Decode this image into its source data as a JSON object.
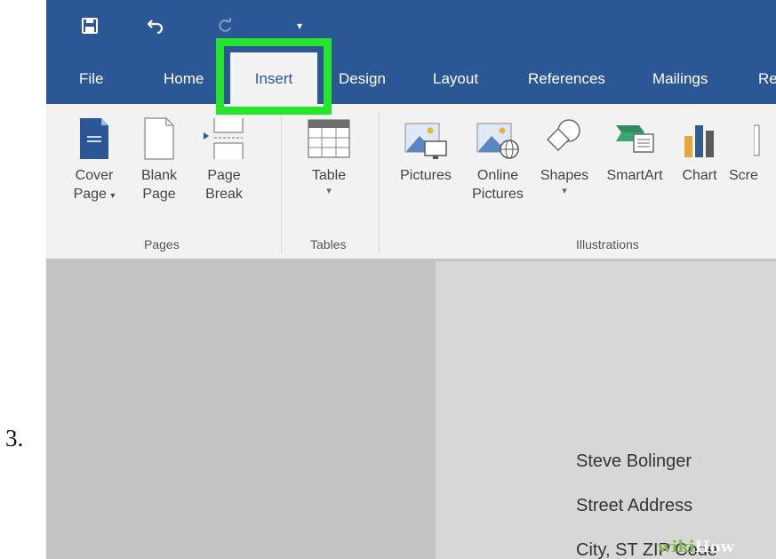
{
  "step": {
    "number": "3."
  },
  "qat": [
    {
      "name": "save-icon",
      "glyph": "🖫"
    },
    {
      "name": "undo-icon",
      "glyph": "↶"
    },
    {
      "name": "redo-icon",
      "glyph": "↻"
    },
    {
      "name": "customize-qat-icon",
      "glyph": "▾"
    }
  ],
  "tabs": [
    "File",
    "Home",
    "Insert",
    "Design",
    "Layout",
    "References",
    "Mailings",
    "Re"
  ],
  "active_tab": "Insert",
  "highlight_color": "#26e62b",
  "ribbon": {
    "pages": {
      "label": "Pages",
      "cover_page": "Cover Page",
      "blank_page": "Blank Page",
      "page_break": "Page Break"
    },
    "tables": {
      "label": "Tables",
      "table": "Table"
    },
    "illustrations": {
      "label": "Illustrations",
      "pictures": "Pictures",
      "online_pictures": "Online Pictures",
      "shapes": "Shapes",
      "smartart": "SmartArt",
      "chart": "Chart",
      "screenshot": "Scre"
    }
  },
  "document": {
    "line1": "Steve Bolinger",
    "line2": "Street Address",
    "line3": "City, ST ZIP Code"
  },
  "watermark": {
    "prefix": "wiki",
    "suffix": "How"
  },
  "colors": {
    "ribbon_blue": "#2b5797",
    "highlight_green": "#26e62b"
  }
}
